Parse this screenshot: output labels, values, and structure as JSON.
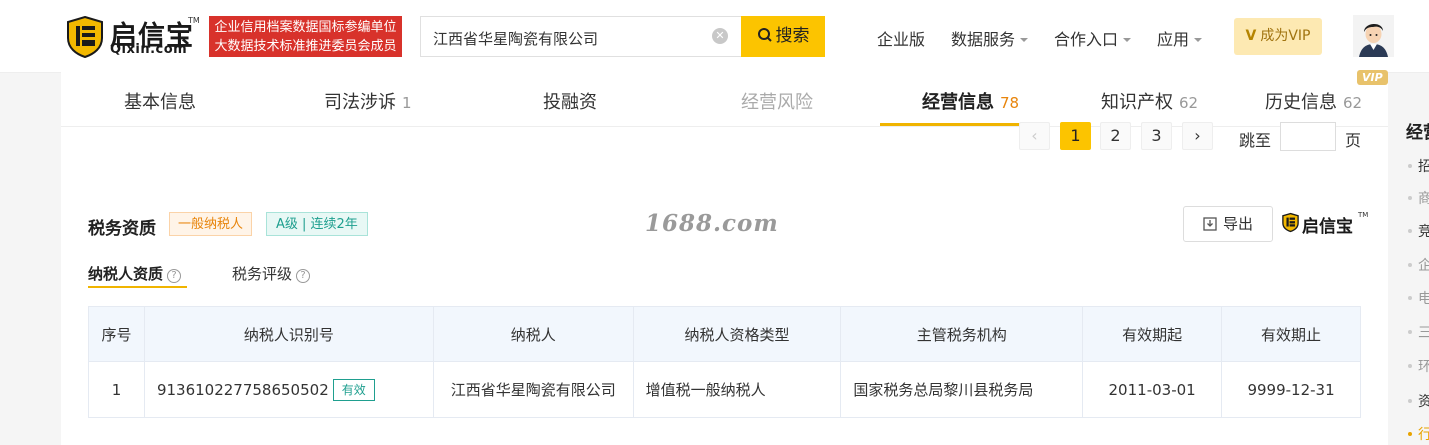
{
  "header": {
    "logo_cn": "启信宝",
    "logo_tm": "TM",
    "logo_en": "Qixin.com",
    "banner_line1": "企业信用档案数据国标参编单位",
    "banner_line2": "大数据技术标准推进委员会成员",
    "search_value": "江西省华星陶瓷有限公司",
    "search_button": "搜索",
    "nav": [
      "企业版",
      "数据服务",
      "合作入口",
      "应用"
    ],
    "vip_button": "成为VIP",
    "vip_mark": "V"
  },
  "tabs": [
    {
      "label": "基本信息",
      "count": ""
    },
    {
      "label": "司法涉诉",
      "count": "1"
    },
    {
      "label": "投融资",
      "count": ""
    },
    {
      "label": "经营风险",
      "count": ""
    },
    {
      "label": "经营信息",
      "count": "78"
    },
    {
      "label": "知识产权",
      "count": "62"
    },
    {
      "label": "历史信息",
      "count": "62"
    }
  ],
  "vip_tag": "VIP",
  "pagination": {
    "prev": "‹",
    "pages": [
      "1",
      "2",
      "3"
    ],
    "next": "›",
    "jump_label": "跳至",
    "page_unit": "页"
  },
  "section": {
    "title": "税务资质",
    "tag_taxpayer": "一般纳税人",
    "tag_rating": "A级 | 连续2年",
    "watermark": "1688.com",
    "export_button": "导出",
    "brand": "启信宝"
  },
  "subtabs": [
    "纳税人资质",
    "税务评级"
  ],
  "table": {
    "headers": [
      "序号",
      "纳税人识别号",
      "纳税人",
      "纳税人资格类型",
      "主管税务机构",
      "有效期起",
      "有效期止"
    ],
    "rows": [
      {
        "index": "1",
        "tax_id": "913610227758650502",
        "status": "有效",
        "taxpayer": "江西省华星陶瓷有限公司",
        "qualification": "增值税一般纳税人",
        "authority": "国家税务总局黎川县税务局",
        "valid_from": "2011-03-01",
        "valid_to": "9999-12-31"
      }
    ]
  },
  "right_panel": {
    "title": "经营",
    "items": [
      "招",
      "商",
      "竞",
      "企",
      "电",
      "三",
      "环",
      "资",
      "行"
    ]
  },
  "colors": {
    "accent": "#fcc400",
    "banner": "#d8322b",
    "active_count": "#e8850c",
    "status_green": "#1f9f8f"
  }
}
